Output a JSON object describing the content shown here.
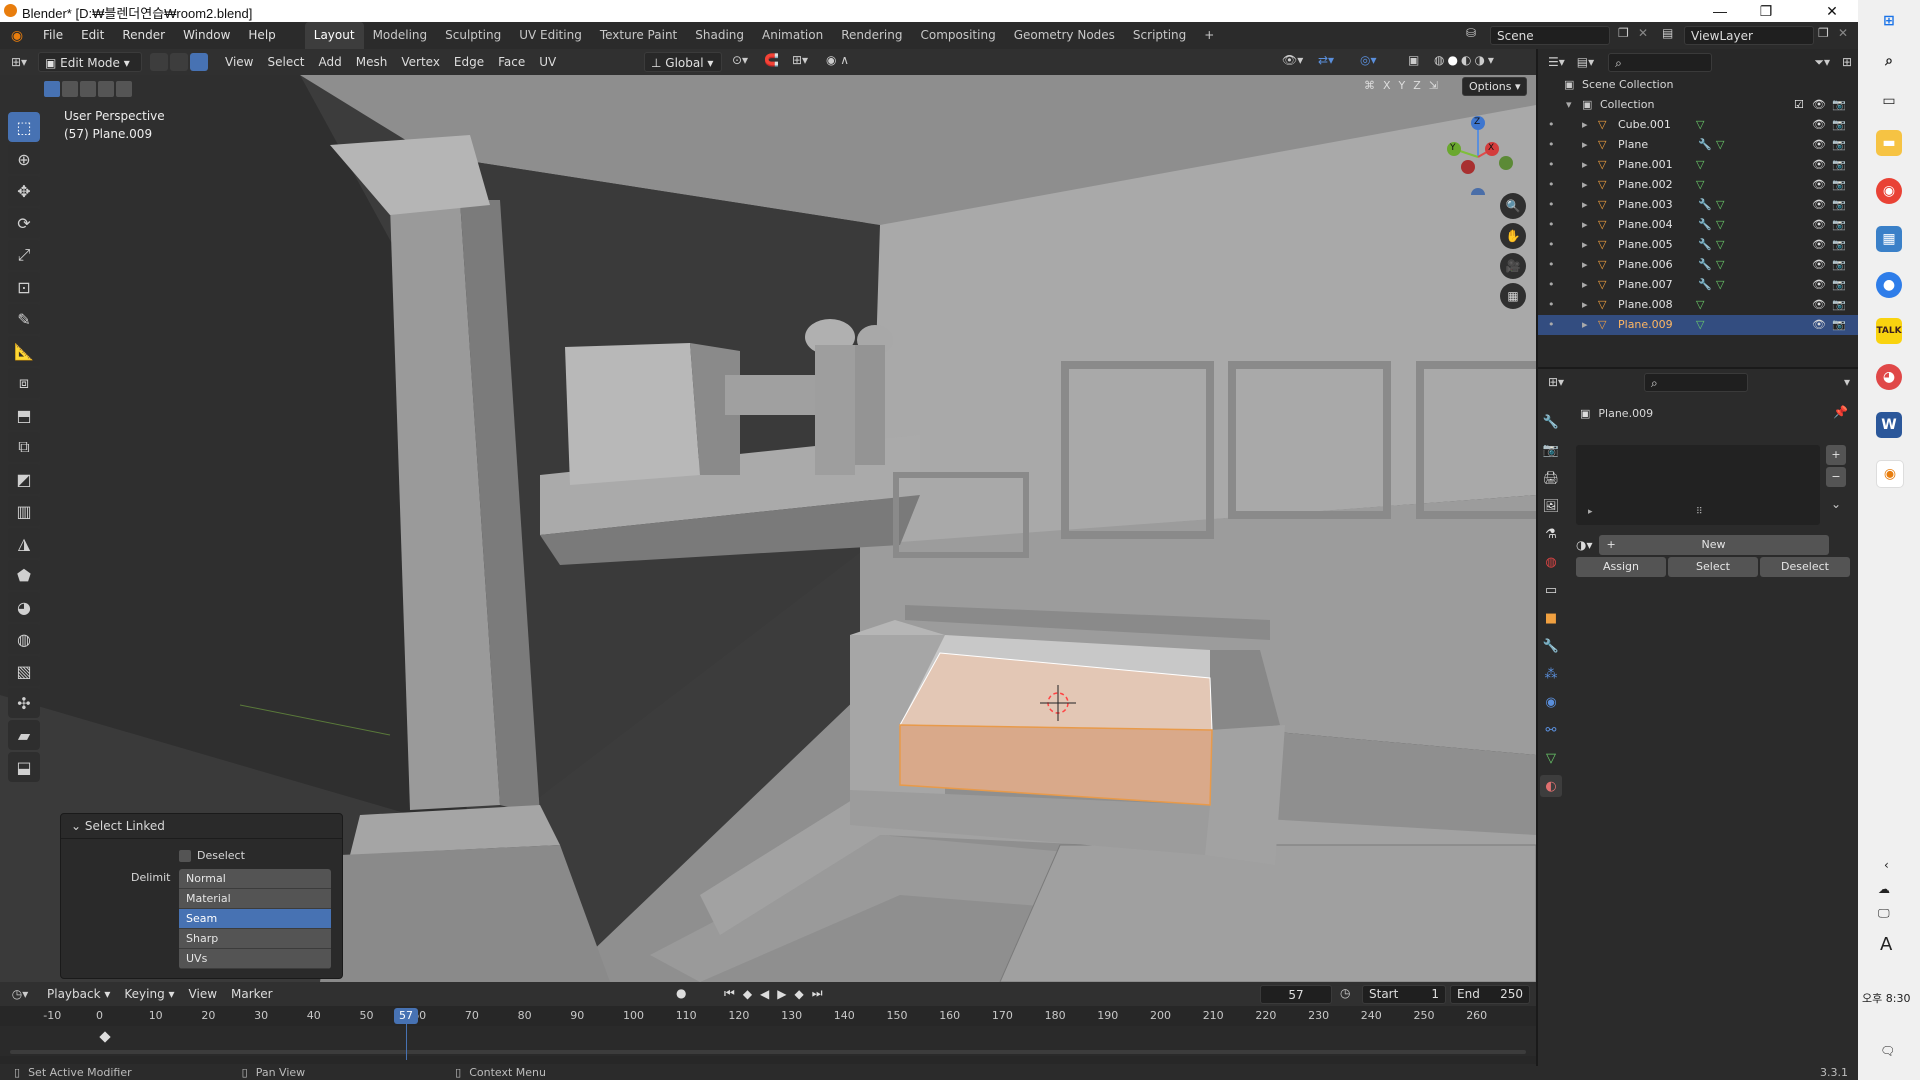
{
  "window": {
    "title": "Blender* [D:₩블렌더연습₩room2.blend]",
    "controls": [
      "—",
      "❐",
      "✕"
    ]
  },
  "menu": {
    "items": [
      "File",
      "Edit",
      "Render",
      "Window",
      "Help"
    ],
    "workspaces": [
      "Layout",
      "Modeling",
      "Sculpting",
      "UV Editing",
      "Texture Paint",
      "Shading",
      "Animation",
      "Rendering",
      "Compositing",
      "Geometry Nodes",
      "Scripting"
    ],
    "active_workspace": "Layout",
    "scene": "Scene",
    "view_layer": "ViewLayer"
  },
  "viewport_header": {
    "mode": "Edit Mode",
    "menus": [
      "View",
      "Select",
      "Add",
      "Mesh",
      "Vertex",
      "Edge",
      "Face",
      "UV"
    ],
    "transform_orientation": "Global",
    "axes": [
      "X",
      "Y",
      "Z"
    ],
    "options_label": "Options"
  },
  "viewport": {
    "perspective": "User Perspective",
    "object_info": "(57) Plane.009"
  },
  "gizmo": {
    "z": "Z",
    "y": "Y",
    "x": "X"
  },
  "operator_panel": {
    "title": "Select Linked",
    "deselect_label": "Deselect",
    "delimit_label": "Delimit",
    "options": [
      "Normal",
      "Material",
      "Seam",
      "Sharp",
      "UVs"
    ],
    "selected_option": "Seam"
  },
  "timeline": {
    "menus": [
      "Playback",
      "Keying",
      "View",
      "Marker"
    ],
    "current_frame": "57",
    "start_label": "Start",
    "start": "1",
    "end_label": "End",
    "end": "250",
    "ticks": [
      "-10",
      "0",
      "10",
      "20",
      "30",
      "40",
      "50",
      "60",
      "70",
      "80",
      "90",
      "100",
      "110",
      "120",
      "130",
      "140",
      "150",
      "160",
      "170",
      "180",
      "190",
      "200",
      "210",
      "220",
      "230",
      "240",
      "250",
      "260"
    ],
    "playhead": "57"
  },
  "status": {
    "left": "Set Active Modifier",
    "middle": "Pan View",
    "right": "Context Menu",
    "version": "3.3.1"
  },
  "outliner": {
    "scene_collection": "Scene Collection",
    "collection": "Collection",
    "objects": [
      {
        "name": "Cube.001",
        "modifier": false
      },
      {
        "name": "Plane",
        "modifier": true
      },
      {
        "name": "Plane.001",
        "modifier": false
      },
      {
        "name": "Plane.002",
        "modifier": false
      },
      {
        "name": "Plane.003",
        "modifier": true
      },
      {
        "name": "Plane.004",
        "modifier": true
      },
      {
        "name": "Plane.005",
        "modifier": true
      },
      {
        "name": "Plane.006",
        "modifier": true
      },
      {
        "name": "Plane.007",
        "modifier": true
      },
      {
        "name": "Plane.008",
        "modifier": false
      },
      {
        "name": "Plane.009",
        "modifier": false,
        "selected": true
      }
    ]
  },
  "properties": {
    "object_name": "Plane.009",
    "new_label": "New",
    "assign_label": "Assign",
    "select_label": "Select",
    "deselect_label": "Deselect"
  },
  "taskbar": {
    "time": "오후 8:30",
    "ime": "A"
  },
  "colors": {
    "accent": "#4772b3",
    "selected_text": "#ffb763",
    "face_select": "#d9a98a",
    "blender_orange": "#e87d0d"
  }
}
